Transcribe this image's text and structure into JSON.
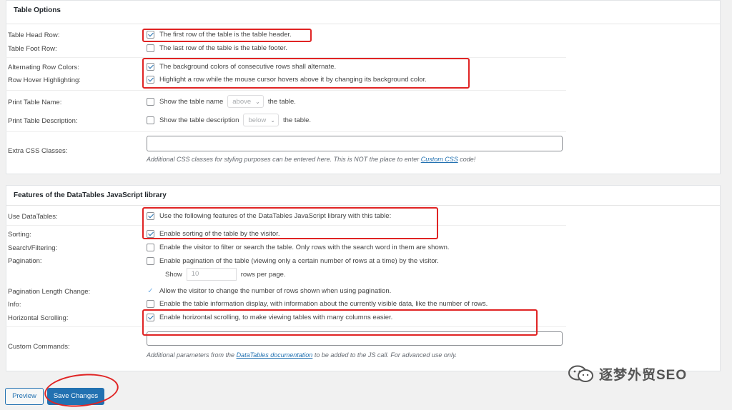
{
  "table_options": {
    "title": "Table Options",
    "rows": {
      "head_row": {
        "label": "Table Head Row:",
        "text": "The first row of the table is the table header.",
        "checked": true
      },
      "foot_row": {
        "label": "Table Foot Row:",
        "text": "The last row of the table is the table footer.",
        "checked": false
      },
      "alternating": {
        "label": "Alternating Row Colors:",
        "text": "The background colors of consecutive rows shall alternate.",
        "checked": true
      },
      "hover": {
        "label": "Row Hover Highlighting:",
        "text": "Highlight a row while the mouse cursor hovers above it by changing its background color.",
        "checked": true
      },
      "print_name": {
        "label": "Print Table Name:",
        "text_before": "Show the table name",
        "select_value": "above",
        "text_after": "the table.",
        "checked": false
      },
      "print_desc": {
        "label": "Print Table Description:",
        "text_before": "Show the table description",
        "select_value": "below",
        "text_after": "the table.",
        "checked": false
      },
      "extra_css": {
        "label": "Extra CSS Classes:",
        "value": "",
        "hint_before": "Additional CSS classes for styling purposes can be entered here. This is NOT the place to enter ",
        "hint_link": "Custom CSS",
        "hint_after": " code!"
      }
    }
  },
  "datatables": {
    "title": "Features of the DataTables JavaScript library",
    "rows": {
      "use": {
        "label": "Use DataTables:",
        "text": "Use the following features of the DataTables JavaScript library with this table:",
        "checked": true
      },
      "sorting": {
        "label": "Sorting:",
        "text": "Enable sorting of the table by the visitor.",
        "checked": true
      },
      "filtering": {
        "label": "Search/Filtering:",
        "text": "Enable the visitor to filter or search the table. Only rows with the search word in them are shown.",
        "checked": false
      },
      "pagination": {
        "label": "Pagination:",
        "text": "Enable pagination of the table (viewing only a certain number of rows at a time) by the visitor.",
        "checked": false,
        "show_label": "Show",
        "rows_value": "10",
        "rows_suffix": "rows per page."
      },
      "length_change": {
        "label": "Pagination Length Change:",
        "text": "Allow the visitor to change the number of rows shown when using pagination.",
        "checked": true
      },
      "info": {
        "label": "Info:",
        "text": "Enable the table information display, with information about the currently visible data, like the number of rows.",
        "checked": false
      },
      "scrolling": {
        "label": "Horizontal Scrolling:",
        "text": "Enable horizontal scrolling, to make viewing tables with many columns easier.",
        "checked": true
      },
      "custom": {
        "label": "Custom Commands:",
        "value": "",
        "hint_before": "Additional parameters from the ",
        "hint_link": "DataTables documentation",
        "hint_after": " to be added to the JS call. For advanced use only."
      }
    }
  },
  "buttons": {
    "preview": "Preview",
    "save": "Save Changes"
  },
  "watermark": {
    "text": "逐梦外贸SEO"
  },
  "colors": {
    "accent": "#2271b1",
    "annotation": "#e02424"
  }
}
